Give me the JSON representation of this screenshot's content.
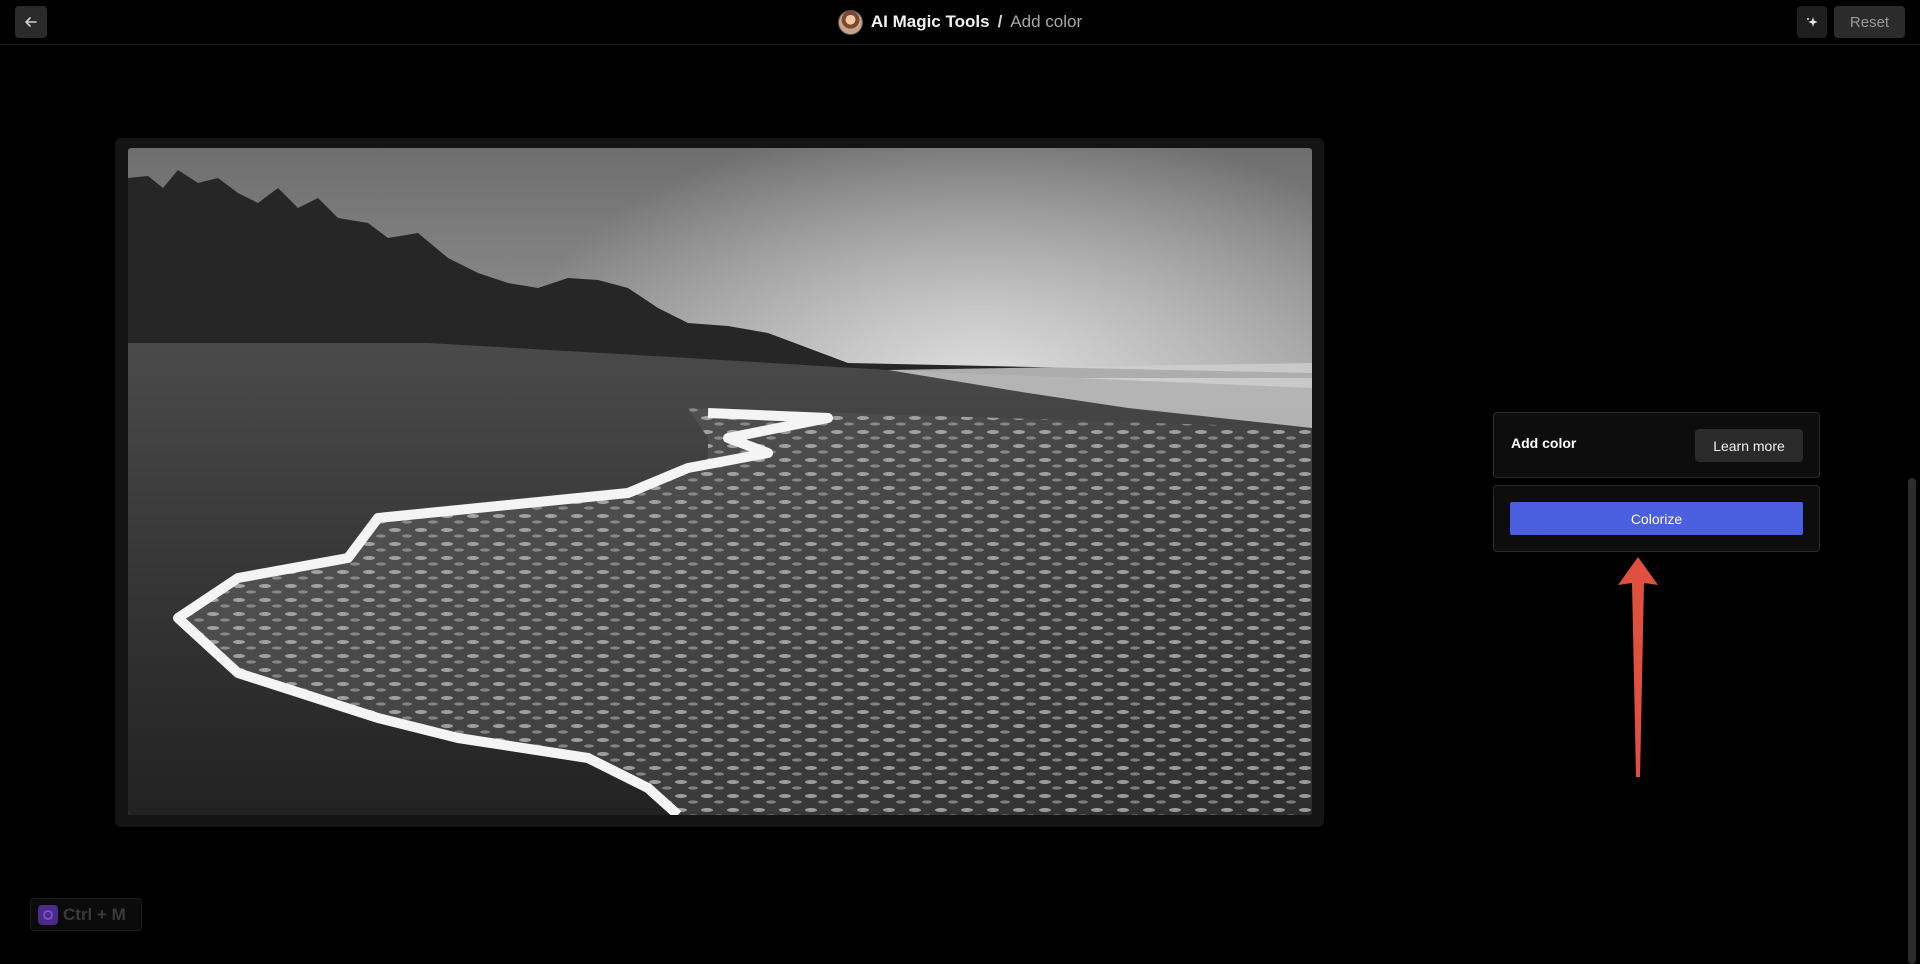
{
  "header": {
    "back_icon": "arrow-left-icon",
    "app_name": "AI Magic Tools",
    "separator": "/",
    "page_name": "Add color",
    "sparkle_icon": "sparkle-icon",
    "reset_label": "Reset"
  },
  "panel": {
    "title": "Add color",
    "learn_more_label": "Learn more",
    "colorize_label": "Colorize"
  },
  "shortcut": {
    "icon": "magic-logo-icon",
    "label": "Ctrl + M"
  },
  "colors": {
    "background": "#000000",
    "accent": "#4a5fe0",
    "annotation_arrow": "#e0503f"
  }
}
